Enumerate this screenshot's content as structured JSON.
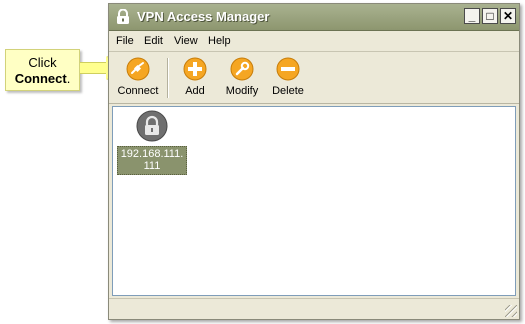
{
  "callout": {
    "line1": "Click",
    "line2_bold": "Connect",
    "line2_tail": "."
  },
  "window": {
    "title": "VPN Access Manager",
    "buttons": {
      "minimize": "_",
      "maximize": "□",
      "close": "✕"
    }
  },
  "menu": [
    "File",
    "Edit",
    "View",
    "Help"
  ],
  "toolbar": {
    "connect": "Connect",
    "add": "Add",
    "modify": "Modify",
    "delete": "Delete"
  },
  "connections": [
    {
      "label": "192.168.111.111"
    }
  ],
  "colors": {
    "title_bar": "#8d966f",
    "toolbar_icon": "#f5a623",
    "callout_bg": "#ffffc4",
    "selection_bg": "#8a936d"
  }
}
